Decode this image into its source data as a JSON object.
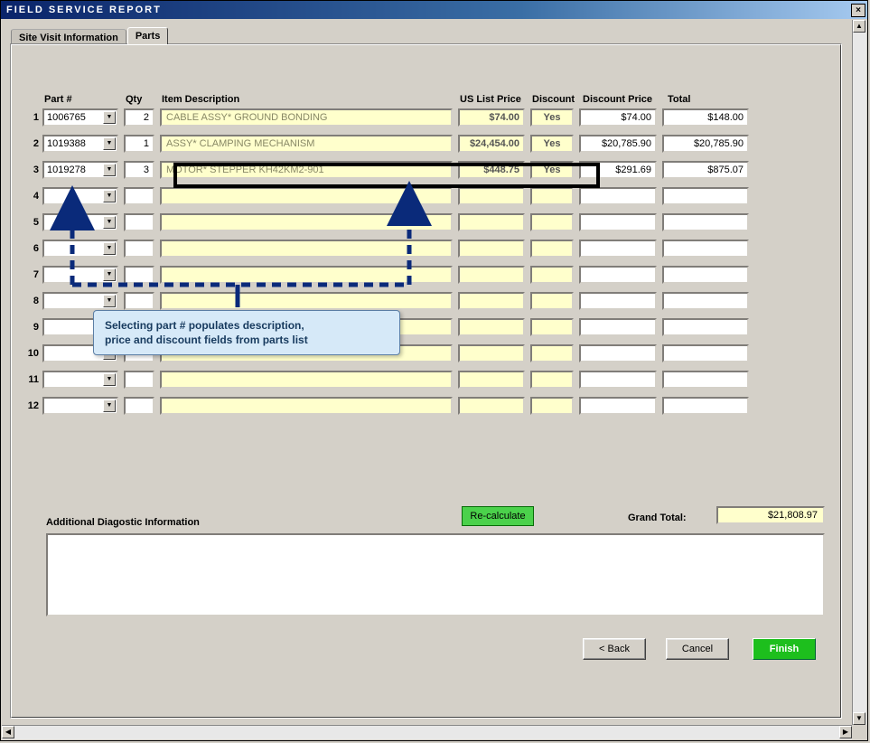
{
  "window": {
    "title": "FIELD SERVICE REPORT"
  },
  "tabs": {
    "site_info": "Site Visit Information",
    "parts": "Parts"
  },
  "columns": {
    "part": "Part #",
    "qty": "Qty",
    "desc": "Item Description",
    "price": "US List Price",
    "discount": "Discount",
    "dprice": "Discount Price",
    "total": "Total"
  },
  "rows": [
    {
      "n": "1",
      "part": "1006765",
      "qty": "2",
      "desc": "CABLE ASSY* GROUND BONDING",
      "price": "$74.00",
      "disc": "Yes",
      "dprice": "$74.00",
      "total": "$148.00"
    },
    {
      "n": "2",
      "part": "1019388",
      "qty": "1",
      "desc": "ASSY* CLAMPING MECHANISM",
      "price": "$24,454.00",
      "disc": "Yes",
      "dprice": "$20,785.90",
      "total": "$20,785.90"
    },
    {
      "n": "3",
      "part": "1019278",
      "qty": "3",
      "desc": "MOTOR* STEPPER KH42KM2-901",
      "price": "$448.75",
      "disc": "Yes",
      "dprice": "$291.69",
      "total": "$875.07"
    },
    {
      "n": "4",
      "part": "",
      "qty": "",
      "desc": "",
      "price": "",
      "disc": "",
      "dprice": "",
      "total": ""
    },
    {
      "n": "5",
      "part": "",
      "qty": "",
      "desc": "",
      "price": "",
      "disc": "",
      "dprice": "",
      "total": ""
    },
    {
      "n": "6",
      "part": "",
      "qty": "",
      "desc": "",
      "price": "",
      "disc": "",
      "dprice": "",
      "total": ""
    },
    {
      "n": "7",
      "part": "",
      "qty": "",
      "desc": "",
      "price": "",
      "disc": "",
      "dprice": "",
      "total": ""
    },
    {
      "n": "8",
      "part": "",
      "qty": "",
      "desc": "",
      "price": "",
      "disc": "",
      "dprice": "",
      "total": ""
    },
    {
      "n": "9",
      "part": "",
      "qty": "",
      "desc": "",
      "price": "",
      "disc": "",
      "dprice": "",
      "total": ""
    },
    {
      "n": "10",
      "part": "",
      "qty": "",
      "desc": "",
      "price": "",
      "disc": "",
      "dprice": "",
      "total": ""
    },
    {
      "n": "11",
      "part": "",
      "qty": "",
      "desc": "",
      "price": "",
      "disc": "",
      "dprice": "",
      "total": ""
    },
    {
      "n": "12",
      "part": "",
      "qty": "",
      "desc": "",
      "price": "",
      "disc": "",
      "dprice": "",
      "total": ""
    }
  ],
  "callout": {
    "line1": "Selecting part # populates description,",
    "line2": "price and discount fields from parts list"
  },
  "buttons": {
    "recalc": "Re-calculate",
    "back": "< Back",
    "cancel": "Cancel",
    "finish": "Finish"
  },
  "labels": {
    "diag": "Additional Diagostic Information",
    "grand": "Grand Total:",
    "grand_value": "$21,808.97"
  }
}
